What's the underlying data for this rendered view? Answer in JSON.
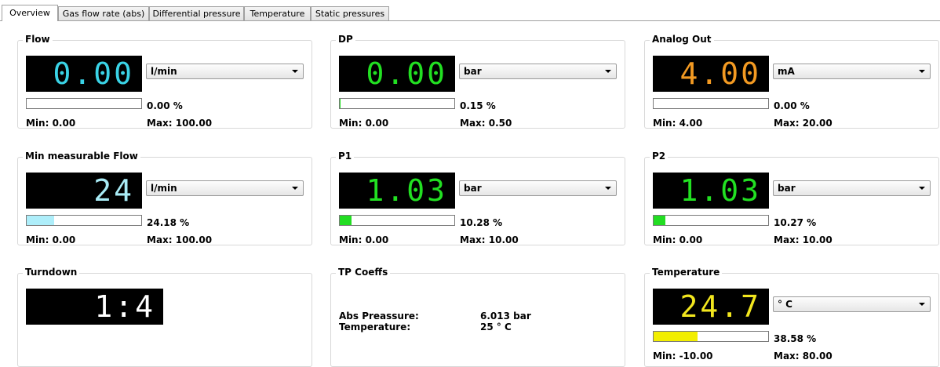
{
  "tabs": [
    "Overview",
    "Gas flow rate (abs)",
    "Differential pressure",
    "Temperature",
    "Static pressures"
  ],
  "panels": {
    "flow": {
      "title": "Flow",
      "value": "0.00",
      "color": "#3ad3e6",
      "unit": "l/min",
      "percent": "0.00 %",
      "fill": 0.0,
      "fill_color": "#9fe7f4",
      "min": "Min: 0.00",
      "max": "Max: 100.00"
    },
    "dp": {
      "title": "DP",
      "value": "0.00",
      "color": "#22e022",
      "unit": "bar",
      "percent": "0.15 %",
      "fill": 0.0015,
      "fill_color": "#22dd22",
      "min": "Min: 0.00",
      "max": "Max: 0.50"
    },
    "analog_out": {
      "title": "Analog Out",
      "value": "4.00",
      "color": "#f39a22",
      "unit": "mA",
      "percent": "0.00 %",
      "fill": 0.0,
      "fill_color": "#f39a22",
      "min": "Min: 4.00",
      "max": "Max: 20.00"
    },
    "min_flow": {
      "title": "Min measurable Flow",
      "value": "24",
      "color": "#a9ecf6",
      "unit": "l/min",
      "percent": "24.18 %",
      "fill": 0.2418,
      "fill_color": "#aeeefa",
      "min": "Min: 0.00",
      "max": "Max: 100.00"
    },
    "p1": {
      "title": "P1",
      "value": "1.03",
      "color": "#22e022",
      "unit": "bar",
      "percent": "10.28 %",
      "fill": 0.1028,
      "fill_color": "#22dd22",
      "min": "Min: 0.00",
      "max": "Max: 10.00"
    },
    "p2": {
      "title": "P2",
      "value": "1.03",
      "color": "#22e022",
      "unit": "bar",
      "percent": "10.27 %",
      "fill": 0.1027,
      "fill_color": "#22dd22",
      "min": "Min: 0.00",
      "max": "Max: 10.00"
    },
    "turndown": {
      "title": "Turndown",
      "value": "1:4",
      "color": "#ffffff"
    },
    "tp_coeffs": {
      "title": "TP Coeffs",
      "abs_label": "Abs Preassure:",
      "abs_value": "6.013 bar",
      "temp_label": "Temperature:",
      "temp_value": "25 ° C"
    },
    "temperature": {
      "title": "Temperature",
      "value": "24.7",
      "color": "#f2e61e",
      "unit": "° C",
      "percent": "38.58 %",
      "fill": 0.3858,
      "fill_color": "#f2ee00",
      "min": "Min: -10.00",
      "max": "Max: 80.00"
    }
  }
}
